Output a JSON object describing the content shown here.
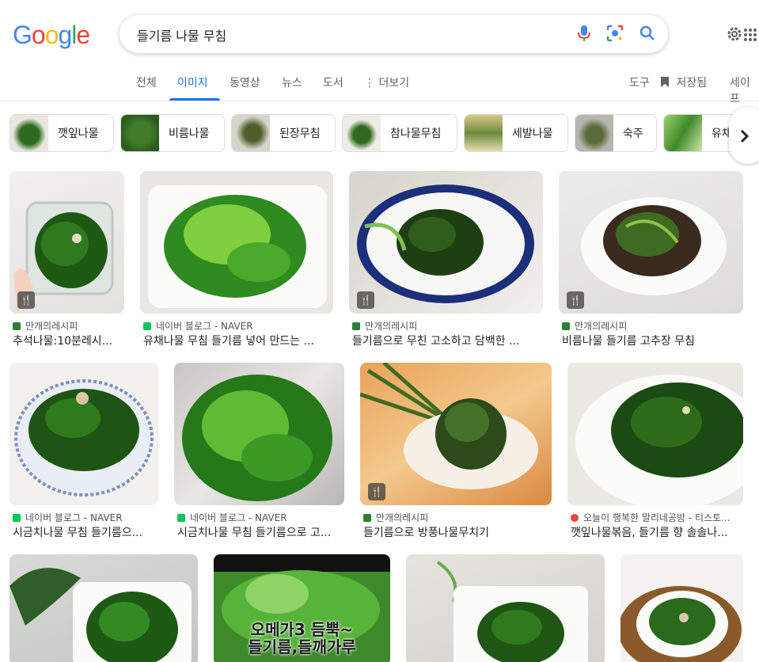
{
  "header": {
    "logo_letters": [
      "G",
      "o",
      "o",
      "g",
      "l",
      "e"
    ],
    "search_value": "들기름 나물 무침",
    "colors": {
      "blue": "#4285f4",
      "red": "#ea4335",
      "yellow": "#fbbc05",
      "green": "#34a853"
    }
  },
  "tabs": {
    "items": [
      "전체",
      "이미지",
      "동영상",
      "뉴스",
      "도서",
      "더보기"
    ],
    "active": "이미지",
    "tools": "도구",
    "saved": "저장됨",
    "safesearch": "세이프"
  },
  "chips": [
    {
      "label": "깻잎나물"
    },
    {
      "label": "비름나물"
    },
    {
      "label": "된장무침"
    },
    {
      "label": "참나물무침"
    },
    {
      "label": "세발나물"
    },
    {
      "label": "숙주"
    },
    {
      "label": "유채"
    }
  ],
  "results": [
    {
      "source": "만개의레시피",
      "title": "추석나물:10분레시...",
      "favicon": "#2e7d32"
    },
    {
      "source": "네이버 블로그 - NAVER",
      "title": "유채나물 무침 들기름 넣어 만드는 ...",
      "favicon": "#03c75a"
    },
    {
      "source": "만개의레시피",
      "title": "들기름으로 무친 고소하고 담백한 ...",
      "favicon": "#2e7d32"
    },
    {
      "source": "만개의레시피",
      "title": "비름나물 들기름 고추장 무침",
      "favicon": "#2e7d32"
    },
    {
      "source": "네이버 블로그 - NAVER",
      "title": "시금치나물 무침 들기름으...",
      "favicon": "#03c75a"
    },
    {
      "source": "네이버 블로그 - NAVER",
      "title": "시금치나물 무침 들기름으로 고...",
      "favicon": "#03c75a"
    },
    {
      "source": "만개의레시피",
      "title": "들기름으로 방풍나물무치기",
      "favicon": "#2e7d32"
    },
    {
      "source": "오늘이 행복한 말리네공방 - 티스토...",
      "title": "깻잎나물볶음, 들기름 향 솔솔나...",
      "favicon": "#e8453c"
    },
    {
      "source": "",
      "title": "",
      "favicon": "#fff"
    },
    {
      "source": "",
      "title": "",
      "favicon": "#fff"
    },
    {
      "source": "",
      "title": "",
      "favicon": "#fff"
    },
    {
      "source": "",
      "title": "",
      "favicon": "#fff"
    }
  ],
  "image_overlay_text": [
    "오메가3 듬뿍~",
    "들기름,들깨가루"
  ],
  "badge_icon": "utensils-icon"
}
